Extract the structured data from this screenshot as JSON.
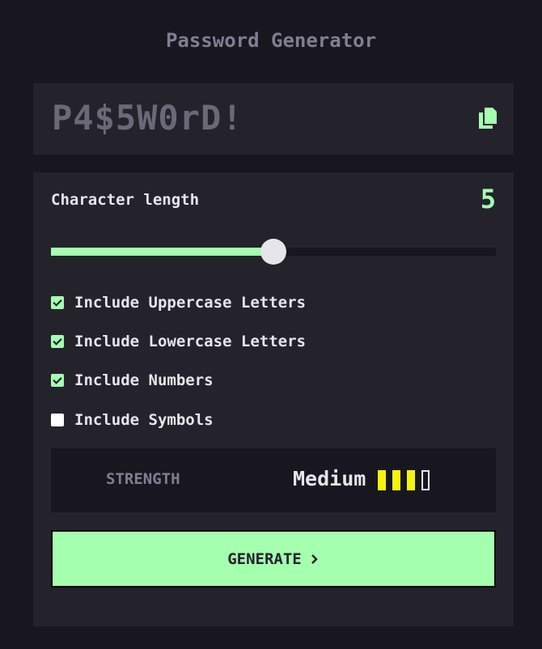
{
  "app": {
    "title": "Password Generator"
  },
  "display": {
    "password": "P4$5W0rD!",
    "copy_icon": "copy-icon"
  },
  "length": {
    "label": "Character length",
    "value": "5",
    "slider_fraction": 0.5
  },
  "options": [
    {
      "label": "Include Uppercase Letters",
      "checked": true
    },
    {
      "label": "Include Lowercase Letters",
      "checked": true
    },
    {
      "label": "Include Numbers",
      "checked": true
    },
    {
      "label": "Include Symbols",
      "checked": false
    }
  ],
  "strength": {
    "label": "STRENGTH",
    "value": "Medium",
    "level": 3,
    "max_level": 4
  },
  "generate": {
    "label": "GENERATE",
    "icon": "arrow-right-icon"
  },
  "colors": {
    "accent": "#a4ffaf",
    "background": "#18171f",
    "panel": "#24232c",
    "strength_bar": "#f5f50a"
  }
}
